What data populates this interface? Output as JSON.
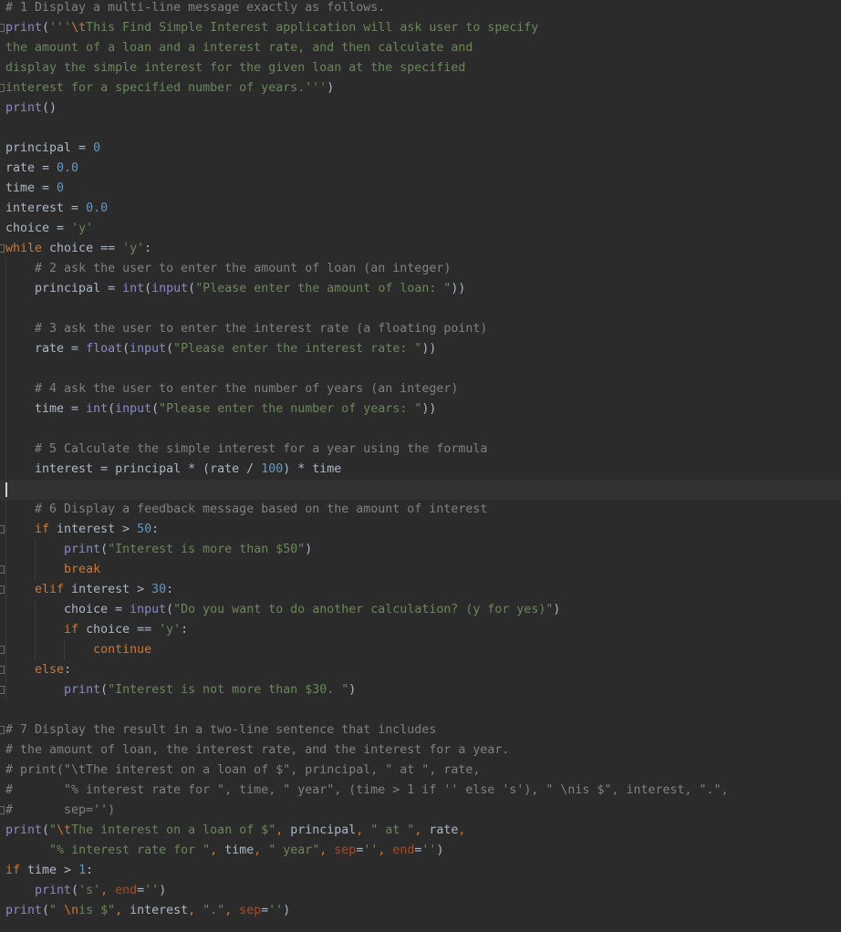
{
  "editor": {
    "theme": {
      "background": "#2b2b2b",
      "current_line": "#323232"
    },
    "caret_line": 24,
    "lines": [
      [
        [
          "cm",
          "# 1 Display a multi-line message exactly as follows."
        ]
      ],
      [
        [
          "bi",
          "print"
        ],
        [
          "tx",
          "("
        ],
        [
          "st",
          "'''"
        ],
        [
          "es",
          "\\t"
        ],
        [
          "st",
          "This Find Simple Interest application will ask user to specify"
        ]
      ],
      [
        [
          "st",
          "the amount of a loan and a interest rate, and then calculate and"
        ]
      ],
      [
        [
          "st",
          "display the simple interest for the given loan at the specified"
        ]
      ],
      [
        [
          "st",
          "interest for a specified number of years.'''"
        ],
        [
          "tx",
          ")"
        ]
      ],
      [
        [
          "bi",
          "print"
        ],
        [
          "tx",
          "()"
        ]
      ],
      [],
      [
        [
          "tx",
          "principal = "
        ],
        [
          "nu",
          "0"
        ]
      ],
      [
        [
          "tx",
          "rate = "
        ],
        [
          "nu",
          "0.0"
        ]
      ],
      [
        [
          "tx",
          "time = "
        ],
        [
          "nu",
          "0"
        ]
      ],
      [
        [
          "tx",
          "interest = "
        ],
        [
          "nu",
          "0.0"
        ]
      ],
      [
        [
          "tx",
          "choice = "
        ],
        [
          "st",
          "'y'"
        ]
      ],
      [
        [
          "kw",
          "while"
        ],
        [
          "tx",
          " choice == "
        ],
        [
          "st",
          "'y'"
        ],
        [
          "tx",
          ":"
        ]
      ],
      [
        [
          "tx",
          "    "
        ],
        [
          "cm",
          "# 2 ask the user to enter the amount of loan (an integer)"
        ]
      ],
      [
        [
          "tx",
          "    principal = "
        ],
        [
          "bi",
          "int"
        ],
        [
          "tx",
          "("
        ],
        [
          "bi",
          "input"
        ],
        [
          "tx",
          "("
        ],
        [
          "st",
          "\"Please enter the amount of loan: \""
        ],
        [
          "tx",
          "))"
        ]
      ],
      [],
      [
        [
          "tx",
          "    "
        ],
        [
          "cm",
          "# 3 ask the user to enter the interest rate (a floating point)"
        ]
      ],
      [
        [
          "tx",
          "    rate = "
        ],
        [
          "bi",
          "float"
        ],
        [
          "tx",
          "("
        ],
        [
          "bi",
          "input"
        ],
        [
          "tx",
          "("
        ],
        [
          "st",
          "\"Please enter the interest rate: \""
        ],
        [
          "tx",
          "))"
        ]
      ],
      [],
      [
        [
          "tx",
          "    "
        ],
        [
          "cm",
          "# 4 ask the user to enter the number of years (an integer)"
        ]
      ],
      [
        [
          "tx",
          "    time = "
        ],
        [
          "bi",
          "int"
        ],
        [
          "tx",
          "("
        ],
        [
          "bi",
          "input"
        ],
        [
          "tx",
          "("
        ],
        [
          "st",
          "\"Please enter the number of years: \""
        ],
        [
          "tx",
          "))"
        ]
      ],
      [],
      [
        [
          "tx",
          "    "
        ],
        [
          "cm",
          "# 5 Calculate the simple interest for a year using the formula"
        ]
      ],
      [
        [
          "tx",
          "    interest = principal * (rate / "
        ],
        [
          "nu",
          "100"
        ],
        [
          "tx",
          ") * time"
        ]
      ],
      [],
      [
        [
          "tx",
          "    "
        ],
        [
          "cm",
          "# 6 Display a feedback message based on the amount of interest"
        ]
      ],
      [
        [
          "tx",
          "    "
        ],
        [
          "kw",
          "if"
        ],
        [
          "tx",
          " interest > "
        ],
        [
          "nu",
          "50"
        ],
        [
          "tx",
          ":"
        ]
      ],
      [
        [
          "tx",
          "        "
        ],
        [
          "bi",
          "print"
        ],
        [
          "tx",
          "("
        ],
        [
          "st",
          "\"Interest is more than $50\""
        ],
        [
          "tx",
          ")"
        ]
      ],
      [
        [
          "tx",
          "        "
        ],
        [
          "kw",
          "break"
        ]
      ],
      [
        [
          "tx",
          "    "
        ],
        [
          "kw",
          "elif"
        ],
        [
          "tx",
          " interest > "
        ],
        [
          "nu",
          "30"
        ],
        [
          "tx",
          ":"
        ]
      ],
      [
        [
          "tx",
          "        choice = "
        ],
        [
          "bi",
          "input"
        ],
        [
          "tx",
          "("
        ],
        [
          "st",
          "\"Do you want to do another calculation? (y for yes)\""
        ],
        [
          "tx",
          ")"
        ]
      ],
      [
        [
          "tx",
          "        "
        ],
        [
          "kw",
          "if"
        ],
        [
          "tx",
          " choice == "
        ],
        [
          "st",
          "'y'"
        ],
        [
          "tx",
          ":"
        ]
      ],
      [
        [
          "tx",
          "            "
        ],
        [
          "kw",
          "continue"
        ]
      ],
      [
        [
          "tx",
          "    "
        ],
        [
          "kw",
          "else"
        ],
        [
          "tx",
          ":"
        ]
      ],
      [
        [
          "tx",
          "        "
        ],
        [
          "bi",
          "print"
        ],
        [
          "tx",
          "("
        ],
        [
          "st",
          "\"Interest is not more than $30. \""
        ],
        [
          "tx",
          ")"
        ]
      ],
      [],
      [
        [
          "cm",
          "# 7 Display the result in a two-line sentence that includes"
        ]
      ],
      [
        [
          "cm",
          "# the amount of loan, the interest rate, and the interest for a year."
        ]
      ],
      [
        [
          "cm",
          "# print(\"\\tThe interest on a loan of $\", principal, \" at \", rate,"
        ]
      ],
      [
        [
          "cm",
          "#       \"% interest rate for \", time, \" year\", (time > 1 if '' else 's'), \" \\nis $\", interest, \".\","
        ]
      ],
      [
        [
          "cm",
          "#       sep='')"
        ]
      ],
      [
        [
          "bi",
          "print"
        ],
        [
          "tx",
          "("
        ],
        [
          "st",
          "\""
        ],
        [
          "es",
          "\\t"
        ],
        [
          "st",
          "The interest on a loan of $\""
        ],
        [
          "es",
          ", "
        ],
        [
          "tx",
          "principal"
        ],
        [
          "es",
          ", "
        ],
        [
          "st",
          "\" at \""
        ],
        [
          "es",
          ", "
        ],
        [
          "tx",
          "rate"
        ],
        [
          "es",
          ","
        ]
      ],
      [
        [
          "tx",
          "      "
        ],
        [
          "st",
          "\"% interest rate for \""
        ],
        [
          "es",
          ", "
        ],
        [
          "tx",
          "time"
        ],
        [
          "es",
          ", "
        ],
        [
          "st",
          "\" year\""
        ],
        [
          "es",
          ", "
        ],
        [
          "kwarg",
          "sep"
        ],
        [
          "tx",
          "="
        ],
        [
          "st",
          "''"
        ],
        [
          "es",
          ", "
        ],
        [
          "kwarg",
          "end"
        ],
        [
          "tx",
          "="
        ],
        [
          "st",
          "''"
        ],
        [
          "tx",
          ")"
        ]
      ],
      [
        [
          "kw",
          "if"
        ],
        [
          "tx",
          " time > "
        ],
        [
          "nu",
          "1"
        ],
        [
          "tx",
          ":"
        ]
      ],
      [
        [
          "tx",
          "    "
        ],
        [
          "bi",
          "print"
        ],
        [
          "tx",
          "("
        ],
        [
          "st",
          "'s'"
        ],
        [
          "es",
          ", "
        ],
        [
          "kwarg",
          "end"
        ],
        [
          "tx",
          "="
        ],
        [
          "st",
          "''"
        ],
        [
          "tx",
          ")"
        ]
      ],
      [
        [
          "bi",
          "print"
        ],
        [
          "tx",
          "("
        ],
        [
          "st",
          "\" "
        ],
        [
          "es",
          "\\n"
        ],
        [
          "st",
          "is $\""
        ],
        [
          "es",
          ", "
        ],
        [
          "tx",
          "interest"
        ],
        [
          "es",
          ", "
        ],
        [
          "st",
          "\".\""
        ],
        [
          "es",
          ", "
        ],
        [
          "kwarg",
          "sep"
        ],
        [
          "tx",
          "="
        ],
        [
          "st",
          "''"
        ],
        [
          "tx",
          ")"
        ]
      ]
    ]
  }
}
